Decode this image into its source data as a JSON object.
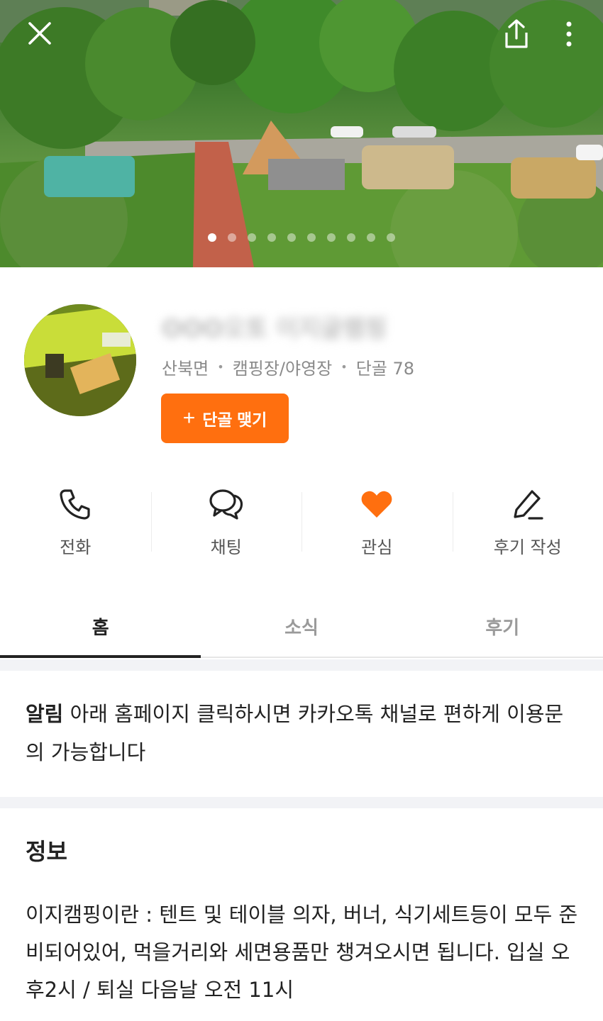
{
  "hero": {
    "image_description_icon": "campsite-photo",
    "close_icon": "close-icon",
    "share_icon": "share-icon",
    "more_icon": "more-vertical-icon",
    "carousel_total": 10,
    "carousel_active": 1
  },
  "profile": {
    "name": "OOO오토 이지글램핑",
    "location": "산북면",
    "category": "캠핑장/야영장",
    "regulars": "단골 78",
    "follow_button": "단골 맺기"
  },
  "actions": [
    {
      "label": "전화",
      "icon": "phone-icon"
    },
    {
      "label": "채팅",
      "icon": "chat-icon"
    },
    {
      "label": "관심",
      "icon": "heart-icon"
    },
    {
      "label": "후기 작성",
      "icon": "pencil-icon"
    }
  ],
  "tabs": [
    {
      "label": "홈",
      "active": true
    },
    {
      "label": "소식",
      "active": false
    },
    {
      "label": "후기",
      "active": false
    }
  ],
  "notice": {
    "tag": "알림",
    "text": "아래 홈페이지 클릭하시면 카카오톡 채널로 편하게 이용문의 가능합니다"
  },
  "info": {
    "title": "정보",
    "body": "이지캠핑이란 : 텐트 및 테이블 의자, 버너, 식기세트등이 모두 준비되어있어, 먹을거리와 세면용품만 챙겨오시면 됩니다. 입실 오후2시 / 퇴실 다음날 오전 11시"
  },
  "colors": {
    "accent": "#ff6f0f",
    "text": "#222222",
    "muted": "#8a8a8a"
  }
}
